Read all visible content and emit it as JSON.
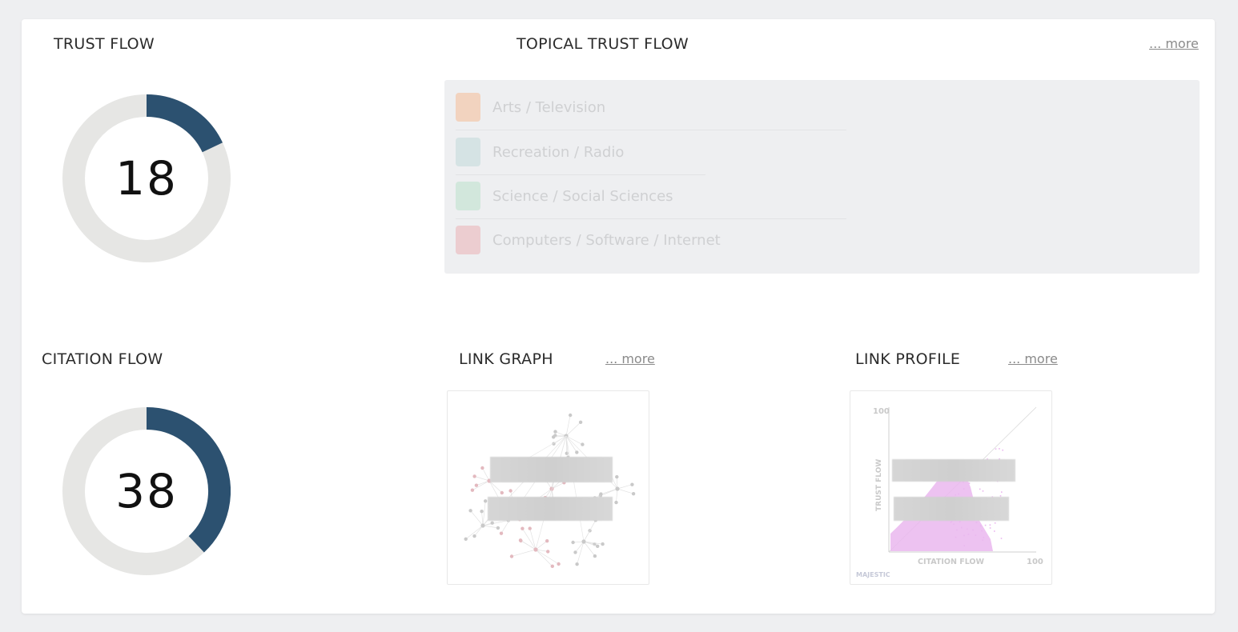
{
  "trust_flow": {
    "title": "TRUST FLOW",
    "value": "18",
    "score": 18,
    "max": 100,
    "colors": {
      "fill": "#2c5170",
      "track": "#e6e6e4"
    }
  },
  "topical_trust_flow": {
    "title": "TOPICAL TRUST FLOW",
    "more_label": "... more",
    "topics": [
      {
        "label": "Arts / Television",
        "color": "#f2d3bf"
      },
      {
        "label": "Recreation / Radio",
        "color": "#d5e3e4"
      },
      {
        "label": "Science / Social Sciences",
        "color": "#d2e7dc"
      },
      {
        "label": "Computers / Software / Internet",
        "color": "#eccdd0"
      }
    ]
  },
  "citation_flow": {
    "title": "CITATION FLOW",
    "value": "38",
    "score": 38,
    "max": 100,
    "colors": {
      "fill": "#2c5170",
      "track": "#e6e6e4"
    }
  },
  "link_graph": {
    "title": "LINK GRAPH",
    "more_label": "... more"
  },
  "link_profile": {
    "title": "LINK PROFILE",
    "more_label": "... more",
    "y_axis_label": "TRUST FLOW",
    "x_axis_label": "CITATION FLOW",
    "y_max_label": "100",
    "x_max_label": "100",
    "brand_label": "MAJESTIC",
    "point_color": "#eab7ef"
  }
}
